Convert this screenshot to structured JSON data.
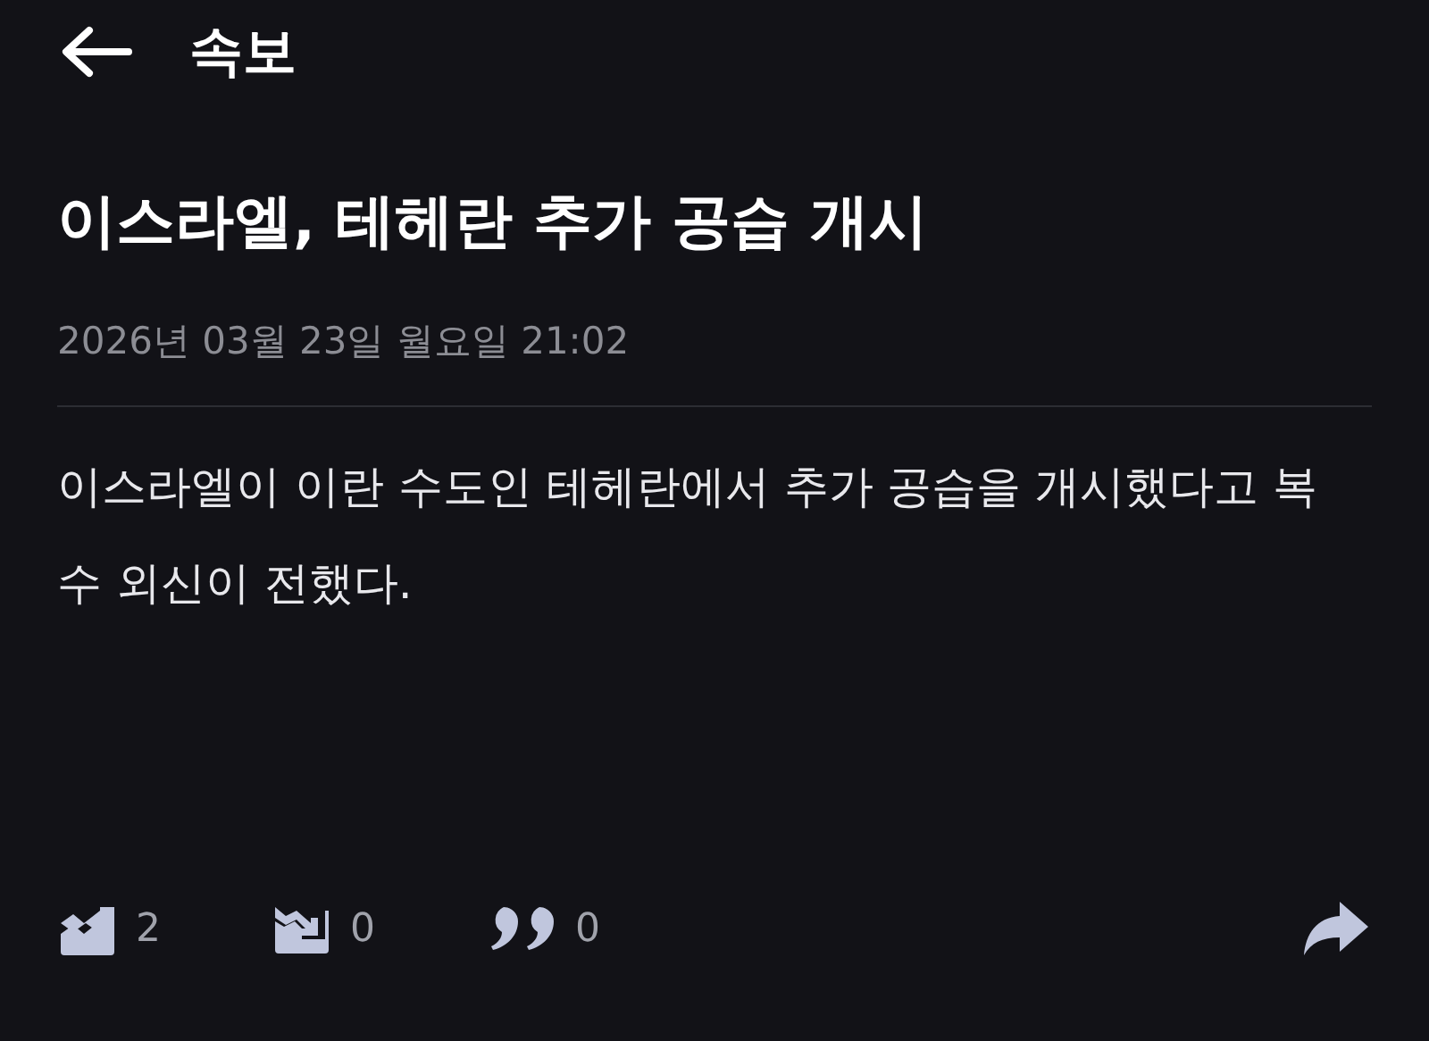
{
  "header": {
    "title": "속보"
  },
  "article": {
    "headline": "이스라엘, 테헤란 추가 공습 개시",
    "date": "2026년 03월 23일 월요일 21:02",
    "body": "이스라엘이 이란 수도인 테헤란에서 추가 공습을 개시했다고 복수 외신이 전했다."
  },
  "stats": [
    {
      "kind": "up",
      "count": "2"
    },
    {
      "kind": "down",
      "count": "0"
    },
    {
      "kind": "quote",
      "count": "0"
    }
  ]
}
